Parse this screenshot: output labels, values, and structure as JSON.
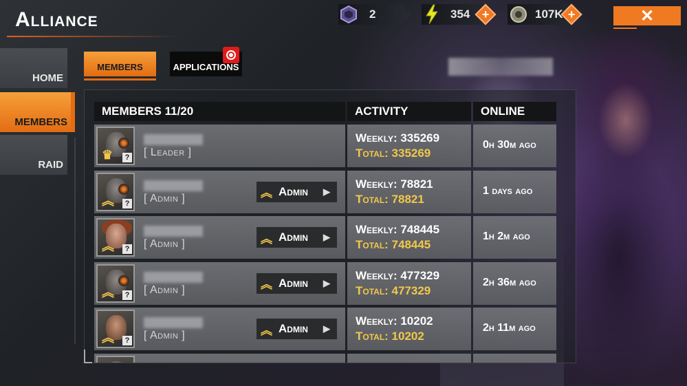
{
  "header": {
    "title": "Alliance",
    "resources": [
      {
        "name": "tokens",
        "icon": "hex-token-icon",
        "value": "2",
        "has_plus": false
      },
      {
        "name": "energy",
        "icon": "lightning-icon",
        "value": "354",
        "has_plus": true
      },
      {
        "name": "credits",
        "icon": "coin-icon",
        "value": "107K",
        "has_plus": true
      }
    ],
    "close_icon": "close-icon"
  },
  "sidebar": {
    "items": [
      {
        "label": "HOME",
        "active": false
      },
      {
        "label": "MEMBERS",
        "active": true
      },
      {
        "label": "RAID",
        "active": false
      }
    ]
  },
  "tabs": [
    {
      "label": "MEMBERS",
      "active": true
    },
    {
      "label": "APPLICATIONS",
      "active": false,
      "notification": true
    }
  ],
  "table": {
    "headers": {
      "members": "MEMBERS 11/20",
      "activity": "ACTIVITY",
      "online": "ONLINE"
    },
    "weekly_label": "Weekly:",
    "total_label": "Total:",
    "rows": [
      {
        "rank": "[ Leader ]",
        "admin_button": null,
        "weekly": "335269",
        "total": "335269",
        "online": "0h 30m ago",
        "avatar": "goggle"
      },
      {
        "rank": "[ Admin ]",
        "admin_button": "Admin",
        "weekly": "78821",
        "total": "78821",
        "online": "1 days ago",
        "avatar": "goggle"
      },
      {
        "rank": "[ Admin ]",
        "admin_button": "Admin",
        "weekly": "748445",
        "total": "748445",
        "online": "1h 2m ago",
        "avatar": "female"
      },
      {
        "rank": "[ Admin ]",
        "admin_button": "Admin",
        "weekly": "477329",
        "total": "477329",
        "online": "2h 36m ago",
        "avatar": "goggle"
      },
      {
        "rank": "[ Admin ]",
        "admin_button": "Admin",
        "weekly": "10202",
        "total": "10202",
        "online": "2h 11m ago",
        "avatar": "punk"
      }
    ]
  },
  "colors": {
    "accent": "#e36c12",
    "gold": "#f2c84a",
    "danger": "#e11a1a"
  }
}
